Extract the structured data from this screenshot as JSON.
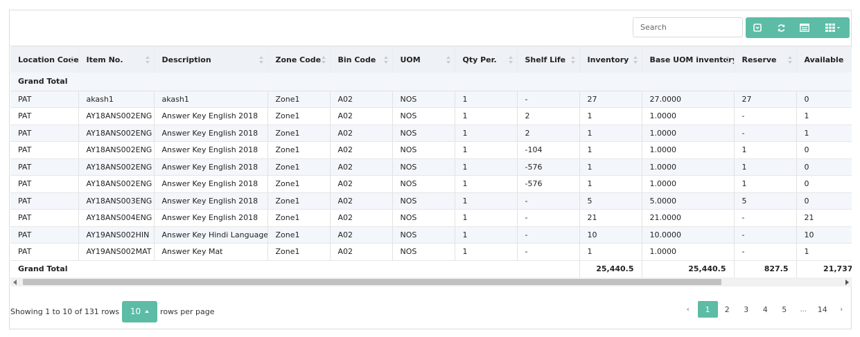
{
  "toolbar": {
    "search_placeholder": "Search",
    "buttons": [
      "export-icon",
      "refresh-icon",
      "toggle-view-icon",
      "columns-icon"
    ]
  },
  "table": {
    "grand_total_label": "Grand Total",
    "columns": [
      "Location Code",
      "Item No.",
      "Description",
      "Zone Code",
      "Bin Code",
      "UOM",
      "Qty Per.",
      "Shelf Life",
      "Inventory",
      "Base UOM inventory",
      "Reserve",
      "Available"
    ],
    "rows": [
      [
        "PAT",
        "akash1",
        "akash1",
        "Zone1",
        "A02",
        "NOS",
        "1",
        "-",
        "27",
        "27.0000",
        "27",
        "0"
      ],
      [
        "PAT",
        "AY18ANS002ENG",
        "Answer Key English 2018",
        "Zone1",
        "A02",
        "NOS",
        "1",
        "2",
        "1",
        "1.0000",
        "-",
        "1"
      ],
      [
        "PAT",
        "AY18ANS002ENG",
        "Answer Key English 2018",
        "Zone1",
        "A02",
        "NOS",
        "1",
        "2",
        "1",
        "1.0000",
        "-",
        "1"
      ],
      [
        "PAT",
        "AY18ANS002ENG",
        "Answer Key English 2018",
        "Zone1",
        "A02",
        "NOS",
        "1",
        "-104",
        "1",
        "1.0000",
        "1",
        "0"
      ],
      [
        "PAT",
        "AY18ANS002ENG",
        "Answer Key English 2018",
        "Zone1",
        "A02",
        "NOS",
        "1",
        "-576",
        "1",
        "1.0000",
        "1",
        "0"
      ],
      [
        "PAT",
        "AY18ANS002ENG",
        "Answer Key English 2018",
        "Zone1",
        "A02",
        "NOS",
        "1",
        "-576",
        "1",
        "1.0000",
        "1",
        "0"
      ],
      [
        "PAT",
        "AY18ANS003ENG",
        "Answer Key English 2018",
        "Zone1",
        "A02",
        "NOS",
        "1",
        "-",
        "5",
        "5.0000",
        "5",
        "0"
      ],
      [
        "PAT",
        "AY18ANS004ENG",
        "Answer Key English 2018",
        "Zone1",
        "A02",
        "NOS",
        "1",
        "-",
        "21",
        "21.0000",
        "-",
        "21"
      ],
      [
        "PAT",
        "AY19ANS002HIN",
        "Answer Key Hindi Language",
        "Zone1",
        "A02",
        "NOS",
        "1",
        "-",
        "10",
        "10.0000",
        "-",
        "10"
      ],
      [
        "PAT",
        "AY19ANS002MAT",
        "Answer Key Mat",
        "Zone1",
        "A02",
        "NOS",
        "1",
        "-",
        "1",
        "1.0000",
        "-",
        "1"
      ]
    ],
    "footer": {
      "label": "Grand Total",
      "inventory": "25,440.5",
      "base_uom_inventory": "25,440.5",
      "reserve": "827.5",
      "available": "21,737"
    }
  },
  "pagination": {
    "showing_text": "Showing 1 to 10 of 131 rows",
    "page_size": "10",
    "rows_per_page_text": "rows per page",
    "prev": "‹",
    "next": "›",
    "pages": [
      "1",
      "2",
      "3",
      "4",
      "5",
      "...",
      "14"
    ],
    "active_page": "1"
  },
  "colors": {
    "accent": "#5cbca6",
    "header_bg": "#eef1f5",
    "stripe_bg": "#f3f6fa"
  }
}
